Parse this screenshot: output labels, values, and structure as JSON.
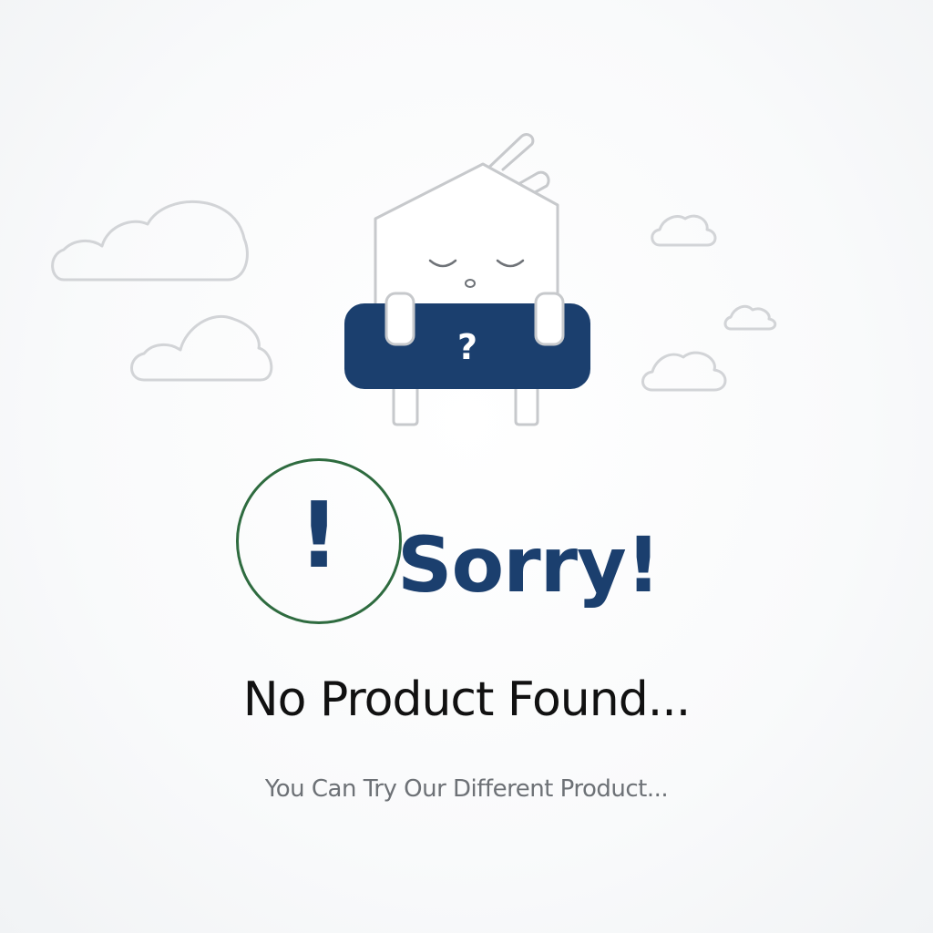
{
  "empty_state": {
    "headline": "Sorry!",
    "alert_symbol": "!",
    "title": "No Product Found...",
    "subtitle": "You Can Try Our Different Product...",
    "badge_symbol": "?"
  },
  "colors": {
    "navy": "#1b3f6e",
    "ring_green": "#2e6b3f",
    "outline_gray": "#c7c9cc",
    "title_text": "#111111",
    "subtitle_text": "#6d7176"
  },
  "icons": [
    "cloud-icon",
    "sleeping-house-icon",
    "question-mark-icon",
    "exclamation-icon"
  ]
}
